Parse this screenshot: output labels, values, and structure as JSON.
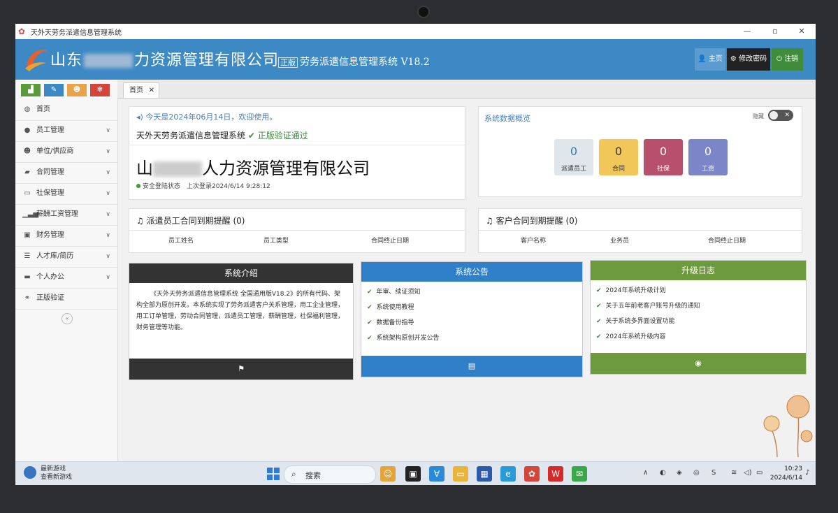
{
  "window": {
    "title": "天外天劳务派遣信息管理系统"
  },
  "header": {
    "company_prefix": "山东",
    "company_suffix": "力资源管理有限公司",
    "edition_badge": "正版",
    "system_name": "劳务派遣信息管理系统 V18.2",
    "buttons": {
      "home": "主页",
      "change_password": "修改密码",
      "logout": "注销"
    }
  },
  "sidebar": {
    "items": [
      {
        "label": "首页",
        "icon": "dashboard-icon"
      },
      {
        "label": "员工管理",
        "icon": "user-icon"
      },
      {
        "label": "单位/供应商",
        "icon": "users-icon"
      },
      {
        "label": "合同管理",
        "icon": "folder-icon"
      },
      {
        "label": "社保管理",
        "icon": "card-icon"
      },
      {
        "label": "薪酬工资管理",
        "icon": "bar-chart-icon"
      },
      {
        "label": "财务管理",
        "icon": "wallet-icon"
      },
      {
        "label": "人才库/简历",
        "icon": "list-icon"
      },
      {
        "label": "个人办公",
        "icon": "laptop-icon"
      },
      {
        "label": "正版验证",
        "icon": "link-icon"
      }
    ]
  },
  "tabs": [
    {
      "label": "首页"
    }
  ],
  "welcome": {
    "date_text": "今天是2024年06月14日，欢迎使用。",
    "verify_system": "天外天劳务派遣信息管理系统",
    "verify_status": "正版验证通过",
    "company_prefix": "山",
    "company_suffix": "人力资源管理有限公司",
    "safe_status": "安全登陆状态",
    "last_login": "上次登录2024/6/14 9:28:12"
  },
  "overview": {
    "title": "系统数据概览",
    "toggle_label": "隐藏",
    "stats": [
      {
        "value": "0",
        "label": "派遣员工",
        "color": "#dfe6ec"
      },
      {
        "value": "0",
        "label": "合同",
        "color": "#f2c75a"
      },
      {
        "value": "0",
        "label": "社保",
        "color": "#b8506b"
      },
      {
        "value": "0",
        "label": "工资",
        "color": "#7b86c9"
      }
    ]
  },
  "employee_reminder": {
    "title": "派遣员工合同到期提醒",
    "count": "(0)",
    "columns": [
      "员工姓名",
      "员工类型",
      "合同终止日期"
    ]
  },
  "customer_reminder": {
    "title": "客户合同到期提醒",
    "count": "(0)",
    "columns": [
      "客户名称",
      "业务员",
      "合同终止日期"
    ]
  },
  "cards": {
    "intro": {
      "title": "系统介绍",
      "text": "《天外天劳务派遣信息管理系统 全国通用版V18.2》的所有代码、架构全部为原创开发。本系统实现了劳务派遣客户关系管理，用工企业管理，用工订单管理，劳动合同管理，派遣员工管理，薪酬管理，社保福利管理，财务管理等功能。"
    },
    "notice": {
      "title": "系统公告",
      "items": [
        "年审、续证须知",
        "系统使用教程",
        "数据备份指导",
        "系统架构原创开发公告"
      ]
    },
    "upgrade": {
      "title": "升级日志",
      "items": [
        "2024年系统升级计划",
        "关于五年前老客户账号升级的通知",
        "关于系统多界面设置功能",
        "2024年系统升级内容"
      ]
    }
  },
  "taskbar": {
    "news_title": "最新游戏",
    "news_sub": "查看新游戏",
    "search_placeholder": "搜索",
    "time": "10:23",
    "date": "2024/6/14"
  },
  "colors": {
    "header": "#3c89c4",
    "intro_header": "#333333",
    "notice_header": "#2f7fc9",
    "upgrade_header": "#6e9a3e"
  }
}
